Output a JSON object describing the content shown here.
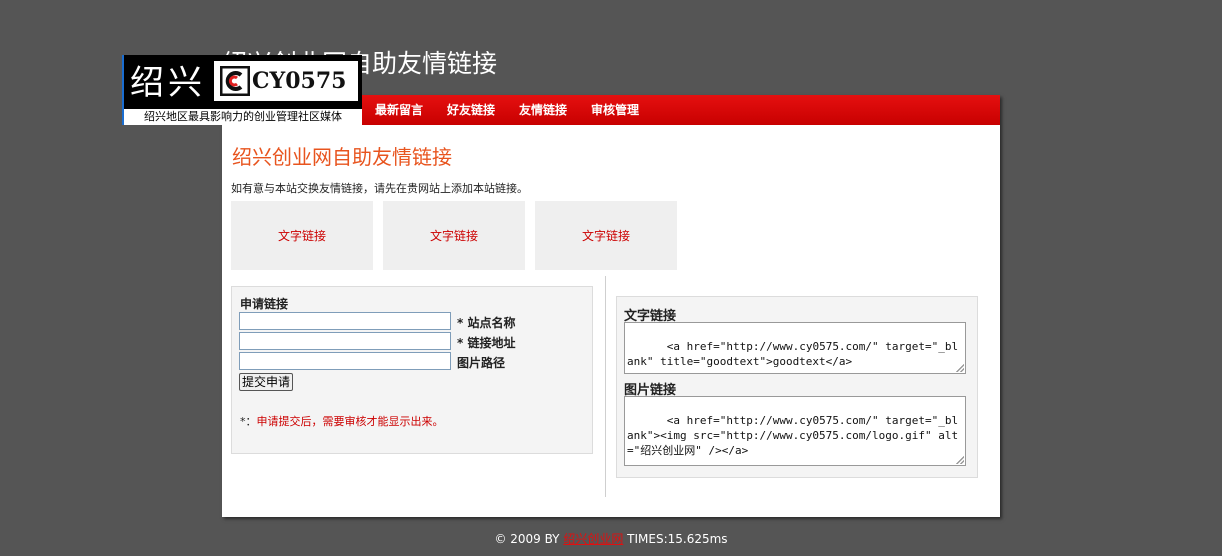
{
  "background_title": "绍兴创业网自助友情链接",
  "logo": {
    "cn_text": "绍兴",
    "en_text": "CY0575",
    "slogan": "绍兴地区最具影响力的创业管理社区媒体"
  },
  "nav": {
    "items": [
      {
        "label": "最新留言"
      },
      {
        "label": "好友链接"
      },
      {
        "label": "友情链接"
      },
      {
        "label": "审核管理"
      }
    ]
  },
  "page": {
    "title": "绍兴创业网自助友情链接",
    "intro": "如有意与本站交换友情链接，请先在贵网站上添加本站链接。"
  },
  "link_boxes": [
    {
      "label": "文字链接"
    },
    {
      "label": "文字链接"
    },
    {
      "label": "文字链接"
    }
  ],
  "apply": {
    "title": "申请链接",
    "fields": [
      {
        "label": "* 站点名称",
        "value": ""
      },
      {
        "label": "* 链接地址",
        "value": ""
      },
      {
        "label": "图片路径",
        "value": ""
      }
    ],
    "submit_label": "提交申请",
    "note_mark": "*：",
    "note_text": "申请提交后，需要审核才能显示出来。"
  },
  "code": {
    "text_label": "文字链接",
    "text_code": "<a href=\"http://www.cy0575.com/\" target=\"_blank\" title=\"goodtext\">goodtext</a>",
    "image_label": "图片链接",
    "image_code": "<a href=\"http://www.cy0575.com/\" target=\"_blank\"><img src=\"http://www.cy0575.com/logo.gif\" alt=\"绍兴创业网\" /></a>"
  },
  "footer": {
    "prefix": "© 2009 BY ",
    "link_text": "绍兴创业网",
    "suffix": " TIMES:15.625ms"
  },
  "colors": {
    "background": "#555555",
    "nav_red": "#d80000",
    "title_orange": "#e8541e",
    "link_red": "#cc0000"
  }
}
